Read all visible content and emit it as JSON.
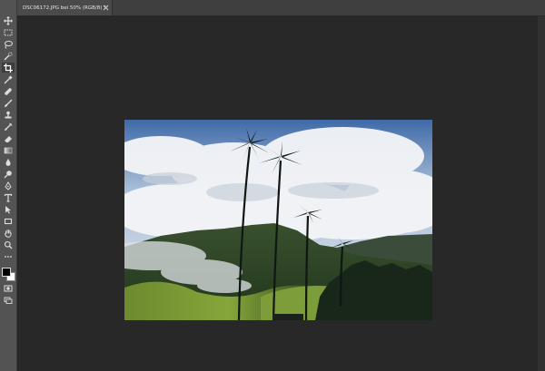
{
  "document_tab": {
    "title": "DSC06172.JPG bei 50% (RGB/8) *"
  },
  "tools": [
    {
      "name": "move-tool",
      "icon": "move-icon"
    },
    {
      "name": "marquee-tool",
      "icon": "rectangular-marquee-icon"
    },
    {
      "name": "lasso-tool",
      "icon": "lasso-icon"
    },
    {
      "name": "quick-selection-tool",
      "icon": "quick-selection-icon"
    },
    {
      "name": "crop-tool",
      "icon": "crop-icon"
    },
    {
      "name": "eyedropper-tool",
      "icon": "eyedropper-icon"
    },
    {
      "name": "healing-brush-tool",
      "icon": "band-aid-icon"
    },
    {
      "name": "brush-tool",
      "icon": "brush-icon"
    },
    {
      "name": "clone-stamp-tool",
      "icon": "stamp-icon"
    },
    {
      "name": "history-brush-tool",
      "icon": "history-brush-icon"
    },
    {
      "name": "eraser-tool",
      "icon": "eraser-icon"
    },
    {
      "name": "gradient-tool",
      "icon": "gradient-icon"
    },
    {
      "name": "blur-tool",
      "icon": "drop-icon"
    },
    {
      "name": "dodge-tool",
      "icon": "dodge-icon"
    },
    {
      "name": "pen-tool",
      "icon": "pen-icon"
    },
    {
      "name": "type-tool",
      "icon": "type-icon"
    },
    {
      "name": "path-selection-tool",
      "icon": "arrow-icon"
    },
    {
      "name": "rectangle-tool",
      "icon": "rectangle-icon"
    },
    {
      "name": "hand-tool",
      "icon": "hand-icon"
    },
    {
      "name": "zoom-tool",
      "icon": "magnifier-icon"
    },
    {
      "name": "more-tools",
      "icon": "ellipsis-icon"
    }
  ],
  "active_tool": "crop-tool",
  "colors": {
    "foreground": "#000000",
    "background": "#ffffff",
    "workspace": "#282828",
    "panel": "#535353"
  }
}
